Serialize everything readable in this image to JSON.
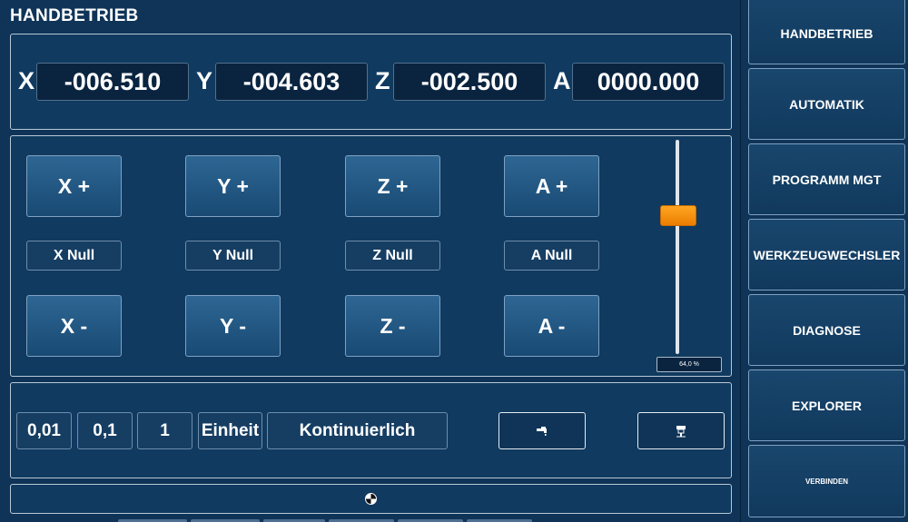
{
  "header": {
    "title": "HANDBETRIEB"
  },
  "coordinates": [
    {
      "axis": "X",
      "value": "-006.510"
    },
    {
      "axis": "Y",
      "value": "-004.603"
    },
    {
      "axis": "Z",
      "value": "-002.500"
    },
    {
      "axis": "A",
      "value": "0000.000"
    }
  ],
  "jog": {
    "plus": [
      "X +",
      "Y +",
      "Z +",
      "A +"
    ],
    "null": [
      "X Null",
      "Y Null",
      "Z Null",
      "A Null"
    ],
    "minus": [
      "X -",
      "Y -",
      "Z -",
      "A -"
    ]
  },
  "feed_override": {
    "value": 0.64,
    "label": "64,0 %"
  },
  "step_modes": [
    "0,01",
    "0,1",
    "1",
    "Einheit",
    "Kontinuierlich"
  ],
  "icons": {
    "coolant": "faucet-icon",
    "spindle": "spindle-icon",
    "status": "status-icon"
  },
  "sidebar": {
    "items": [
      "HANDBETRIEB",
      "AUTOMATIK",
      "PROGRAMM MGT",
      "WERKZEUGWECHSLER",
      "DIAGNOSE",
      "EXPLORER",
      "VERBINDEN"
    ]
  },
  "colors": {
    "background": "#0f3457",
    "accent": "#f08a00"
  }
}
